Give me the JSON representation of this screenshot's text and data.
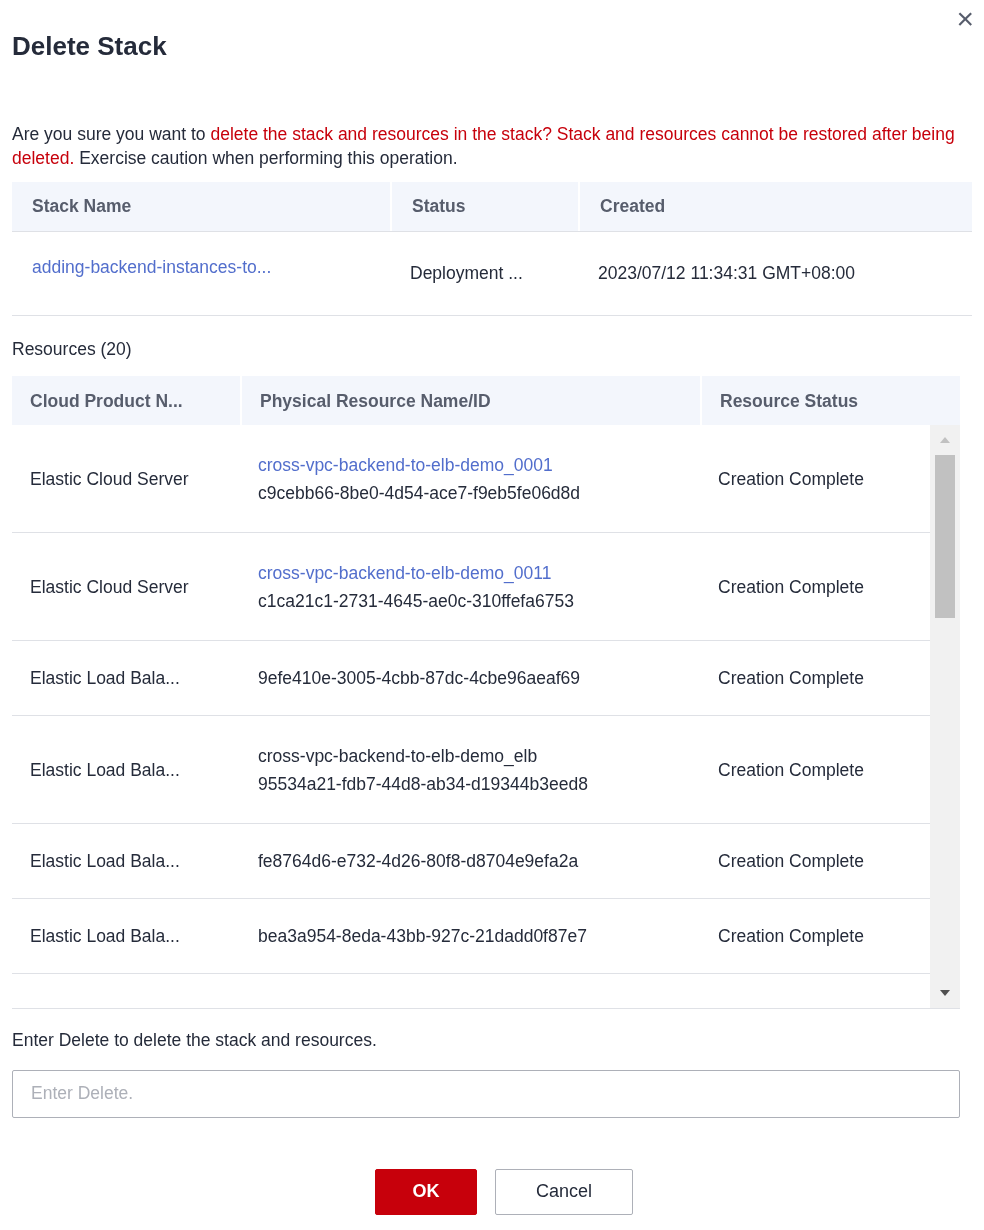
{
  "dialog": {
    "title": "Delete Stack",
    "close": "×"
  },
  "warning": [
    {
      "kind": "normal",
      "text": "Are you sure you want to "
    },
    {
      "kind": "danger",
      "text": "delete the stack and resources in the stack? Stack and resources cannot be restored after being deleted."
    },
    {
      "kind": "normal",
      "text": " Exercise caution when performing this operation."
    }
  ],
  "stack_table": {
    "columns": [
      "Stack Name",
      "Status",
      "Created"
    ],
    "rows": [
      {
        "name": "adding-backend-instances-to...",
        "status": "Deployment ...",
        "created": "2023/07/12 11:34:31 GMT+08:00"
      }
    ]
  },
  "resources_label": "Resources (20)",
  "resources_table": {
    "columns": [
      "Cloud Product N...",
      "Physical Resource Name/ID",
      "Resource Status"
    ],
    "rows": [
      {
        "product": "Elastic Cloud Server",
        "name": {
          "kind": "link",
          "text": "cross-vpc-backend-to-elb-demo_0001"
        },
        "id": "c9cebb66-8be0-4d54-ace7-f9eb5fe06d8d",
        "status": "Creation Complete"
      },
      {
        "product": "Elastic Cloud Server",
        "name": {
          "kind": "link",
          "text": "cross-vpc-backend-to-elb-demo_0011"
        },
        "id": "c1ca21c1-2731-4645-ae0c-310ffefa6753",
        "status": "Creation Complete"
      },
      {
        "product": "Elastic Load Bala...",
        "id": "9efe410e-3005-4cbb-87dc-4cbe96aeaf69",
        "status": "Creation Complete"
      },
      {
        "product": "Elastic Load Bala...",
        "name": {
          "kind": "text",
          "text": "cross-vpc-backend-to-elb-demo_elb"
        },
        "id": "95534a21-fdb7-44d8-ab34-d19344b3eed8",
        "status": "Creation Complete"
      },
      {
        "product": "Elastic Load Bala...",
        "id": "fe8764d6-e732-4d26-80f8-d8704e9efa2a",
        "status": "Creation Complete"
      },
      {
        "product": "Elastic Load Bala...",
        "id": "bea3a954-8eda-43bb-927c-21dadd0f87e7",
        "status": "Creation Complete"
      }
    ]
  },
  "confirm": {
    "label": "Enter Delete to delete the stack and resources.",
    "placeholder": "Enter Delete."
  },
  "buttons": [
    {
      "kind": "primary",
      "label": "OK"
    },
    {
      "kind": "secondary",
      "label": "Cancel"
    }
  ]
}
